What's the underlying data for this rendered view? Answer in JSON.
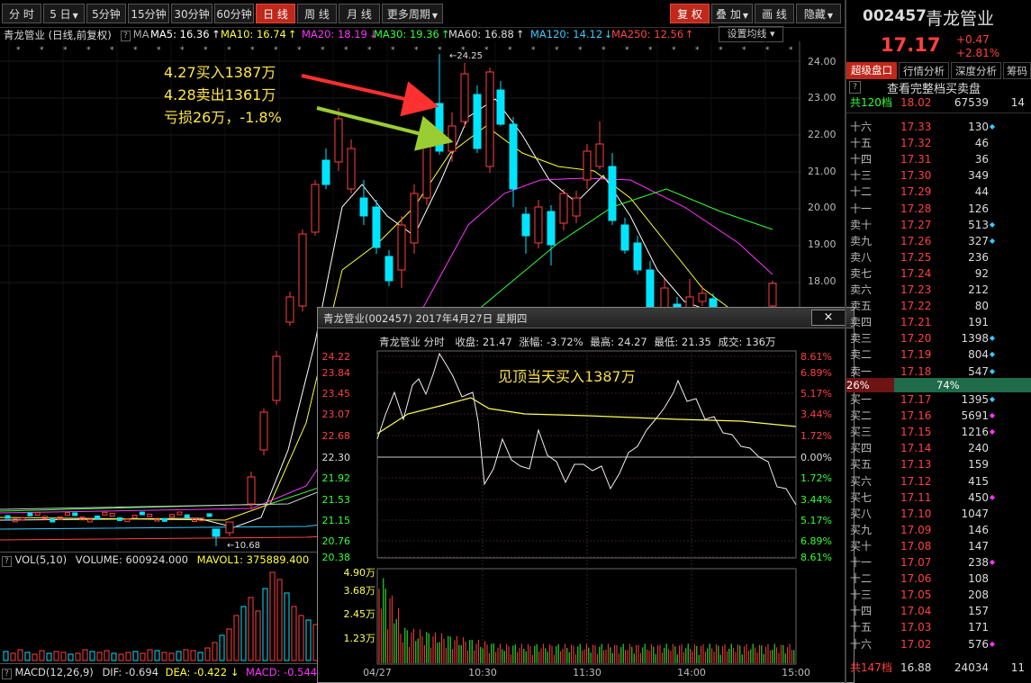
{
  "toolbar": {
    "left": [
      "分 时",
      "5 日",
      "5分钟",
      "15分钟",
      "30分钟",
      "60分钟",
      "日 线",
      "周 线",
      "月 线",
      "更多周期"
    ],
    "right": [
      "复 权",
      "叠 加",
      "画 线",
      "隐藏"
    ]
  },
  "stock": {
    "code": "002457",
    "name": "青龙管业",
    "price": "17.17",
    "change": "+0.47",
    "change_pct": "+2.81%"
  },
  "chart_header": {
    "title": "青龙管业 (日线,前复权)",
    "ma_label": "MA",
    "ma": [
      {
        "label": "MA5: 16.36",
        "color": "#ffffff"
      },
      {
        "label": "MA10: 16.74",
        "color": "#ffff33"
      },
      {
        "label": "MA20: 18.19",
        "color": "#ff33ff"
      },
      {
        "label": "MA30: 19.36",
        "color": "#33ff33"
      },
      {
        "label": "MA60: 16.88",
        "color": "#dddddd"
      },
      {
        "label": "MA120: 14.12",
        "color": "#33ccff"
      },
      {
        "label": "MA250: 12.56",
        "color": "#ff4444"
      }
    ],
    "setting": "设置均线"
  },
  "y_axis": [
    "24.00",
    "23.00",
    "22.00",
    "21.00",
    "20.00",
    "19.00",
    "18.00"
  ],
  "peak_label": "24.25",
  "low_label": "10.68",
  "annotation": {
    "line1": "4.27买入1387万",
    "line2": "4.28卖出1361万",
    "line3": "亏损26万，-1.8%"
  },
  "vol_header": {
    "name": "VOL(5,10)",
    "volume": "VOLUME: 600924.000",
    "mavol": "MAVOL1: 375889.400"
  },
  "macd_header": {
    "name": "MACD(12,26,9)",
    "dif": "DIF: -0.694",
    "dea": "DEA: -0.422",
    "macd": "MACD: -0.544"
  },
  "popup": {
    "title": "青龙管业(002457) 2017年4月27日 星期四",
    "close": "×",
    "info_name": "青龙管业 分时",
    "close_price": "收盘: 21.47",
    "change": "涨幅: -3.72%",
    "high": "最高: 24.27",
    "low": "最低: 21.35",
    "turnover": "成交: 136万",
    "note": "见顶当天买入1387万",
    "left_prices": [
      "24.22",
      "23.84",
      "23.45",
      "23.07",
      "22.68",
      "22.30",
      "21.92",
      "21.53",
      "21.15",
      "20.76",
      "20.38"
    ],
    "right_pcts": [
      "8.61%",
      "6.89%",
      "5.17%",
      "3.44%",
      "1.72%",
      "0.00%",
      "1.72%",
      "3.44%",
      "5.17%",
      "6.89%",
      "8.61%"
    ],
    "vol_labels": [
      "4.90万",
      "3.68万",
      "2.45万",
      "1.23万"
    ],
    "times": [
      "04/27",
      "10:30",
      "11:30",
      "14:00",
      "15:00"
    ]
  },
  "right_panel": {
    "tabs": [
      "超级盘口",
      "行情分析",
      "深度分析",
      "筹码"
    ],
    "help": "?",
    "full_link": "查看完整档买卖盘",
    "total_ask": {
      "label": "共120档",
      "price": "18.02",
      "vol": "67539",
      "cnt": "14"
    },
    "asks": [
      {
        "lvl": "十六",
        "price": "17.33",
        "vol": "130",
        "mk": "◆",
        "mkc": "#33ccff",
        "cnt": "19"
      },
      {
        "lvl": "十五",
        "price": "17.32",
        "vol": "46",
        "mk": "",
        "mkc": "",
        "cnt": "6"
      },
      {
        "lvl": "十四",
        "price": "17.31",
        "vol": "36",
        "mk": "",
        "mkc": "",
        "cnt": "7"
      },
      {
        "lvl": "十三",
        "price": "17.30",
        "vol": "349",
        "mk": "",
        "mkc": "",
        "cnt": "10"
      },
      {
        "lvl": "十二",
        "price": "17.29",
        "vol": "44",
        "mk": "",
        "mkc": "",
        "cnt": "7"
      },
      {
        "lvl": "十一",
        "price": "17.28",
        "vol": "126",
        "mk": "",
        "mkc": "",
        "cnt": "16"
      },
      {
        "lvl": "卖十",
        "price": "17.27",
        "vol": "513",
        "mk": "◆",
        "mkc": "#33ccff",
        "cnt": "47"
      },
      {
        "lvl": "卖九",
        "price": "17.26",
        "vol": "327",
        "mk": "◆",
        "mkc": "#33ccff",
        "cnt": "41"
      },
      {
        "lvl": "卖八",
        "price": "17.25",
        "vol": "236",
        "mk": "",
        "mkc": "",
        "cnt": "8"
      },
      {
        "lvl": "卖七",
        "price": "17.24",
        "vol": "92",
        "mk": "",
        "mkc": "",
        "cnt": "15"
      },
      {
        "lvl": "卖六",
        "price": "17.23",
        "vol": "212",
        "mk": "",
        "mkc": "",
        "cnt": "13"
      },
      {
        "lvl": "卖五",
        "price": "17.22",
        "vol": "80",
        "mk": "",
        "mkc": "",
        "cnt": "7"
      },
      {
        "lvl": "卖四",
        "price": "17.21",
        "vol": "191",
        "mk": "",
        "mkc": "",
        "cnt": "15"
      },
      {
        "lvl": "卖三",
        "price": "17.20",
        "vol": "1398",
        "mk": "◆",
        "mkc": "#33ccff",
        "cnt": "12"
      },
      {
        "lvl": "卖二",
        "price": "17.19",
        "vol": "804",
        "mk": "◆",
        "mkc": "#33ccff",
        "cnt": "17"
      },
      {
        "lvl": "卖一",
        "price": "17.18",
        "vol": "547",
        "mk": "◆",
        "mkc": "#33ccff",
        "cnt": "14"
      }
    ],
    "ratio": {
      "left": "26%",
      "right": "74%",
      "left_pct": 26
    },
    "bids": [
      {
        "lvl": "买一",
        "price": "17.17",
        "vol": "1395",
        "mk": "◆",
        "mkc": "#33ccff",
        "cnt": "14"
      },
      {
        "lvl": "买二",
        "price": "17.16",
        "vol": "5691",
        "mk": "◆",
        "mkc": "#ff33ff",
        "cnt": "12"
      },
      {
        "lvl": "买三",
        "price": "17.15",
        "vol": "1216",
        "mk": "◆",
        "mkc": "#ff33ff",
        "cnt": "13"
      },
      {
        "lvl": "买四",
        "price": "17.14",
        "vol": "240",
        "mk": "",
        "mkc": "",
        "cnt": "11"
      },
      {
        "lvl": "买五",
        "price": "17.13",
        "vol": "159",
        "mk": "",
        "mkc": "",
        "cnt": "5"
      },
      {
        "lvl": "买六",
        "price": "17.12",
        "vol": "415",
        "mk": "",
        "mkc": "",
        "cnt": "8"
      },
      {
        "lvl": "买七",
        "price": "17.11",
        "vol": "450",
        "mk": "◆",
        "mkc": "#ff33ff",
        "cnt": "10"
      },
      {
        "lvl": "买八",
        "price": "17.10",
        "vol": "1047",
        "mk": "",
        "mkc": "",
        "cnt": "7"
      },
      {
        "lvl": "买九",
        "price": "17.09",
        "vol": "146",
        "mk": "",
        "mkc": "",
        "cnt": "10"
      },
      {
        "lvl": "买十",
        "price": "17.08",
        "vol": "147",
        "mk": "",
        "mkc": "",
        "cnt": "6"
      },
      {
        "lvl": "十一",
        "price": "17.07",
        "vol": "238",
        "mk": "◆",
        "mkc": "#ff33ff",
        "cnt": "22"
      },
      {
        "lvl": "十二",
        "price": "17.06",
        "vol": "108",
        "mk": "",
        "mkc": "",
        "cnt": "7"
      },
      {
        "lvl": "十三",
        "price": "17.05",
        "vol": "208",
        "mk": "",
        "mkc": "",
        "cnt": "8"
      },
      {
        "lvl": "十四",
        "price": "17.04",
        "vol": "157",
        "mk": "",
        "mkc": "",
        "cnt": "10"
      },
      {
        "lvl": "十五",
        "price": "17.03",
        "vol": "171",
        "mk": "",
        "mkc": "",
        "cnt": "9"
      },
      {
        "lvl": "十六",
        "price": "17.02",
        "vol": "576",
        "mk": "◆",
        "mkc": "#ff33ff",
        "cnt": "29"
      }
    ],
    "total_bid": {
      "label": "共147档",
      "price": "16.88",
      "vol": "24034",
      "cnt": "11"
    }
  },
  "colors": {
    "up": "#ff4040",
    "down": "#00e5ff",
    "bg": "#000000",
    "accent": "#c0281b"
  }
}
